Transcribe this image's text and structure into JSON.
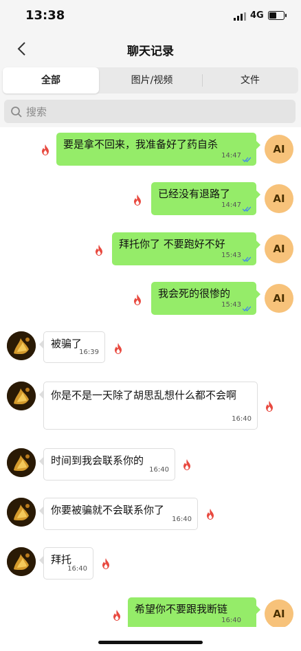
{
  "status": {
    "time": "13:38",
    "network": "4G"
  },
  "nav": {
    "title": "聊天记录"
  },
  "tabs": [
    {
      "label": "全部"
    },
    {
      "label": "图片/视频"
    },
    {
      "label": "文件"
    }
  ],
  "search": {
    "placeholder": "搜索"
  },
  "avatar_ai_label": "AI",
  "messages": [
    {
      "text": "要是拿不回来，我准备好了药自杀",
      "time": "14:47"
    },
    {
      "text": "已经没有退路了",
      "time": "14:47"
    },
    {
      "text": "拜托你了 不要跑好不好",
      "time": "15:43"
    },
    {
      "text": "我会死的很惨的",
      "time": "15:43"
    },
    {
      "text": "被骗了",
      "time": "16:39"
    },
    {
      "text": "你是不是一天除了胡思乱想什么都不会啊",
      "time": "16:40"
    },
    {
      "text": "时间到我会联系你的",
      "time": "16:40"
    },
    {
      "text": "你要被骗就不会联系你了",
      "time": "16:40"
    },
    {
      "text": "拜托",
      "time": "16:40"
    },
    {
      "text": "希望你不要跟我断链",
      "time": "16:40"
    }
  ],
  "colors": {
    "outgoing_bubble": "#95ec69",
    "incoming_bubble": "#ffffff",
    "ai_avatar": "#f7c27a",
    "flame": "#e8493f",
    "read_check": "#3f86f0"
  }
}
